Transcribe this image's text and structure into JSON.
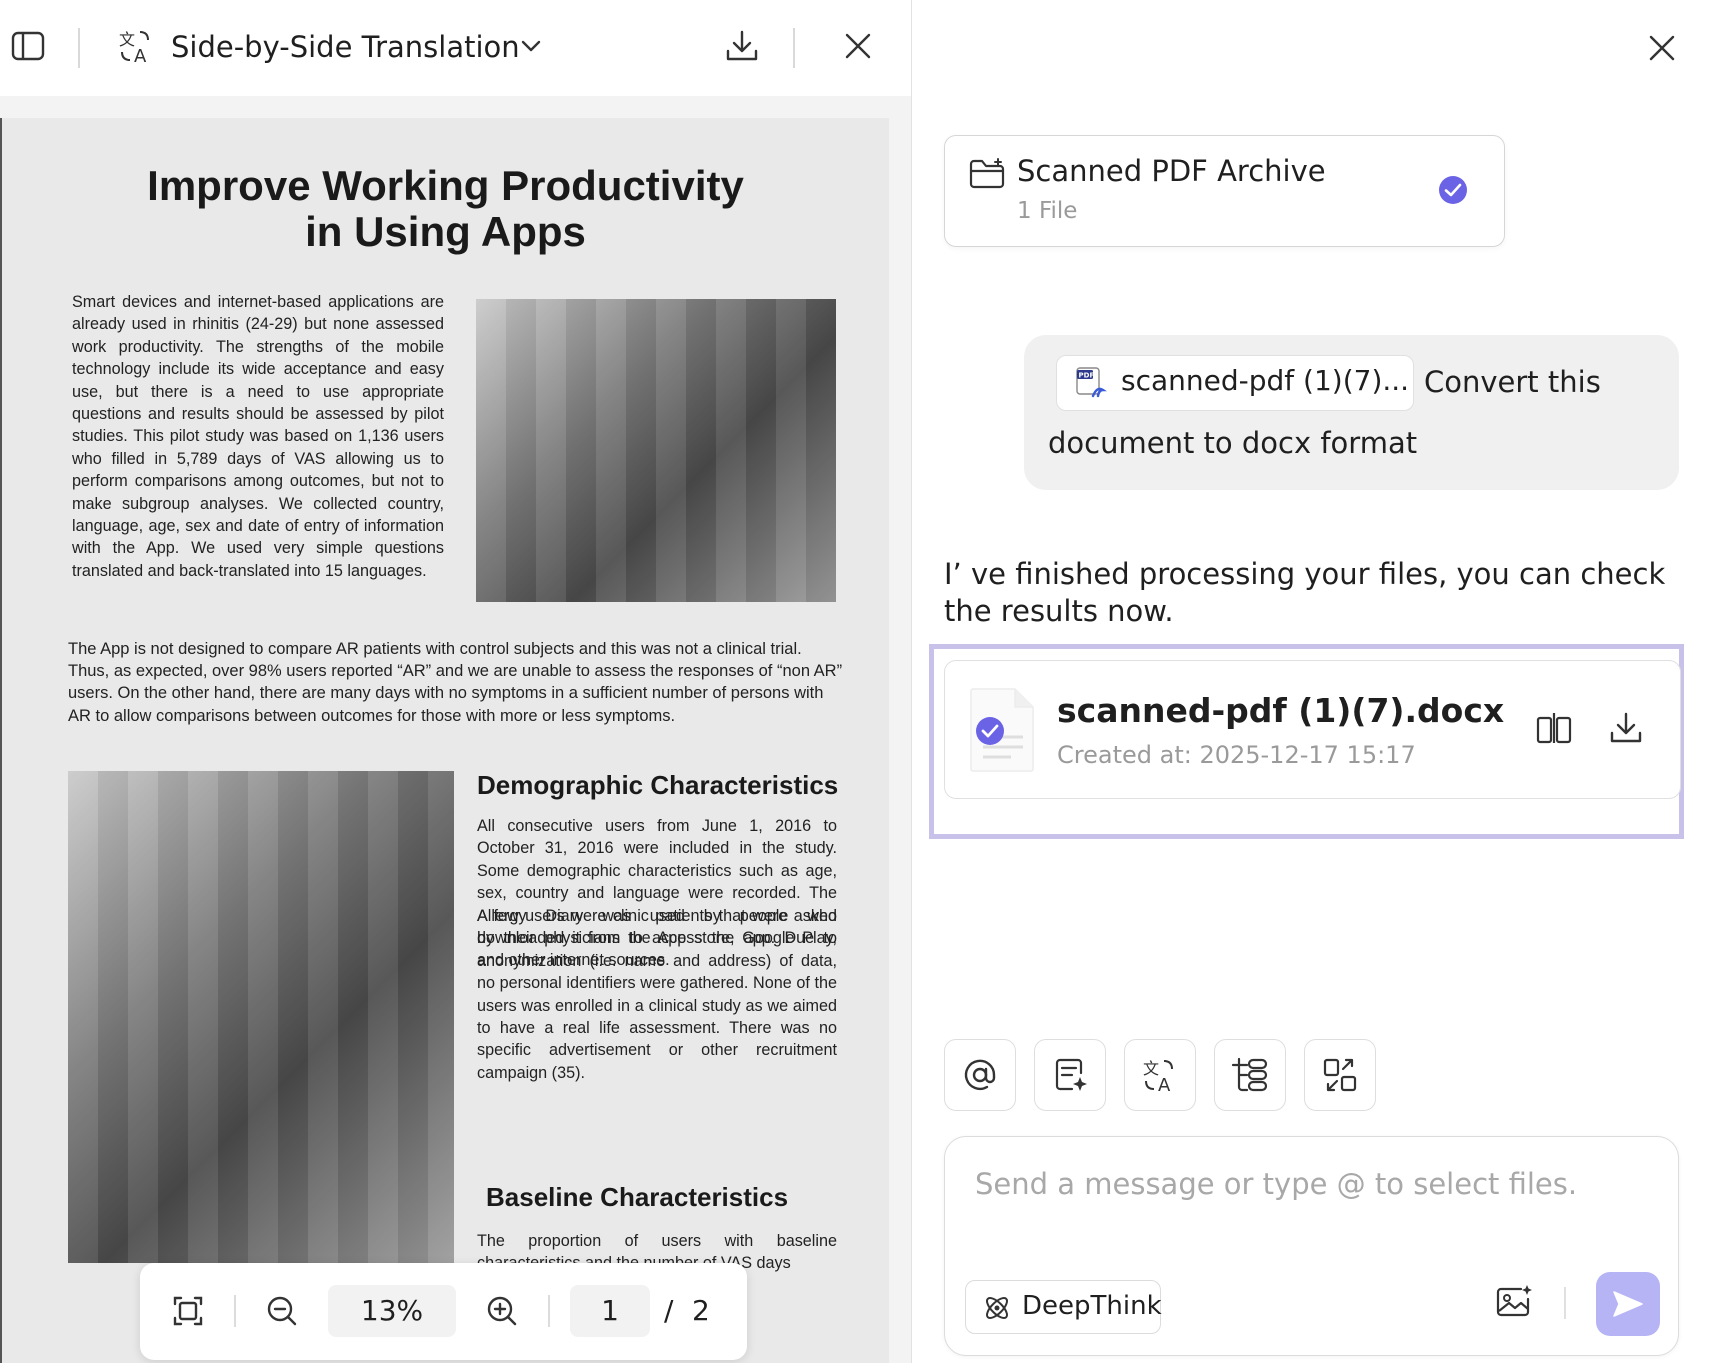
{
  "viewer": {
    "title": "Side-by-Side Translation",
    "zoom": "13%",
    "page_current": "1",
    "page_separator": "/",
    "page_total": "2"
  },
  "document": {
    "title_line1": "Improve Working Productivity",
    "title_line2": "in Using Apps",
    "para1": "Smart devices and internet-based applications are already used in rhinitis (24-29) but none assessed work productivity. The strengths of the mobile technology include its wide acceptance and easy use, but there is a need to use appropriate questions and results should be assessed by pilot studies. This pilot study was based on 1,136 users who filled in 5,789 days of VAS allowing us to perform comparisons among outcomes, but not to make subgroup analyses. We collected country, language, age, sex and date of entry of information with the App. We used very simple questions translated and back-translated into 15 languages.",
    "para2": "The App is not designed to compare AR patients with control subjects and this was not a clinical trial. Thus, as expected, over 98% users reported “AR” and we are unable to assess the responses of “non AR” users. On the other hand, there are many days with no symptoms in a sufficient number of persons with AR to allow comparisons between outcomes for those with more or less symptoms.",
    "heading_demographic": "Demographic Characteristics",
    "para3": "All consecutive users from June 1, 2016 to October 31, 2016 were included in the study. Some demographic characteristics such as age, sex, country and language were recorded. The Allergy Diary was used by people who downloaded it from the App store, Google Play, and other internet sources.",
    "para4": "A few users were clinic patients that were asked by their physicians to access the app. Due to anonymization (i.e. name and address) of data, no personal identifiers were gathered. None of the users was enrolled in a clinical study as we aimed to have a real life assessment. There was no specific advertisement or other recruitment campaign (35).",
    "heading_baseline": "Baseline Characteristics",
    "para5": "The proportion of users with baseline characteristics and the number of VAS days"
  },
  "chat": {
    "archive": {
      "title": "Scanned PDF Archive",
      "subtitle": "1 File"
    },
    "user_message": {
      "file_chip": "scanned-pdf (1)(7)...",
      "text_line1": "Convert this",
      "text_line2": "document to docx format"
    },
    "assistant_reply": "I’  ve finished processing your files, you can check the results now.",
    "result_file": {
      "name": "scanned-pdf (1)(7).docx",
      "created": "Created at: 2025-12-17 15:17"
    },
    "input_placeholder": "Send a message or type @ to select files.",
    "deepthink_label": "DeepThink"
  },
  "colors": {
    "accent": "#6b63e6",
    "send_button": "#b6b4f5",
    "highlight_frame": "#c8c2ea"
  }
}
